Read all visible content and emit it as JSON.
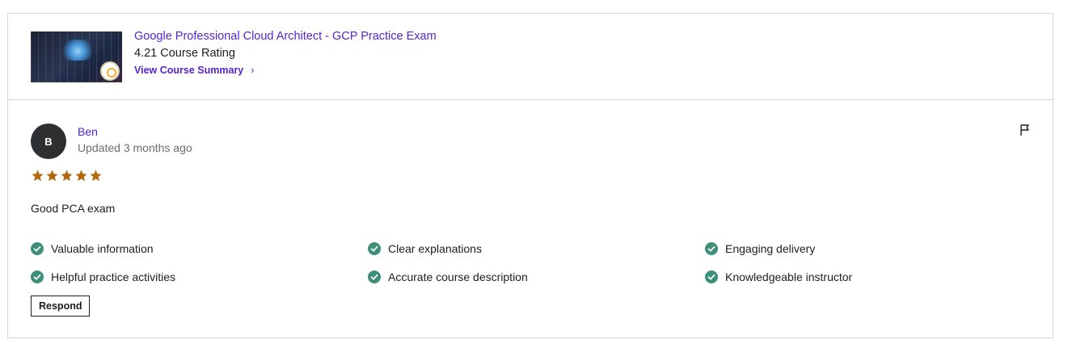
{
  "course": {
    "title": "Google Professional Cloud Architect - GCP Practice Exam",
    "rating_text": "4.21 Course Rating",
    "summary_link": "View Course Summary",
    "thumbnail_icon": "cloud-thumbnail"
  },
  "review": {
    "avatar_initial": "B",
    "reviewer_name": "Ben",
    "updated": "Updated 3 months ago",
    "stars": 5,
    "max_stars": 5,
    "text": "Good PCA exam",
    "feedback": [
      "Valuable information",
      "Clear explanations",
      "Engaging delivery",
      "Helpful practice activities",
      "Accurate course description",
      "Knowledgeable instructor"
    ],
    "respond_label": "Respond"
  },
  "colors": {
    "link": "#5624d0",
    "star": "#b4690e",
    "check": "#3d8f7a",
    "avatar_bg": "#2d2f31",
    "border": "#d1d7dc"
  },
  "icons": {
    "flag": "flag-icon",
    "check": "check-circle-icon",
    "star": "star-icon",
    "chevron": "chevron-right-icon"
  }
}
